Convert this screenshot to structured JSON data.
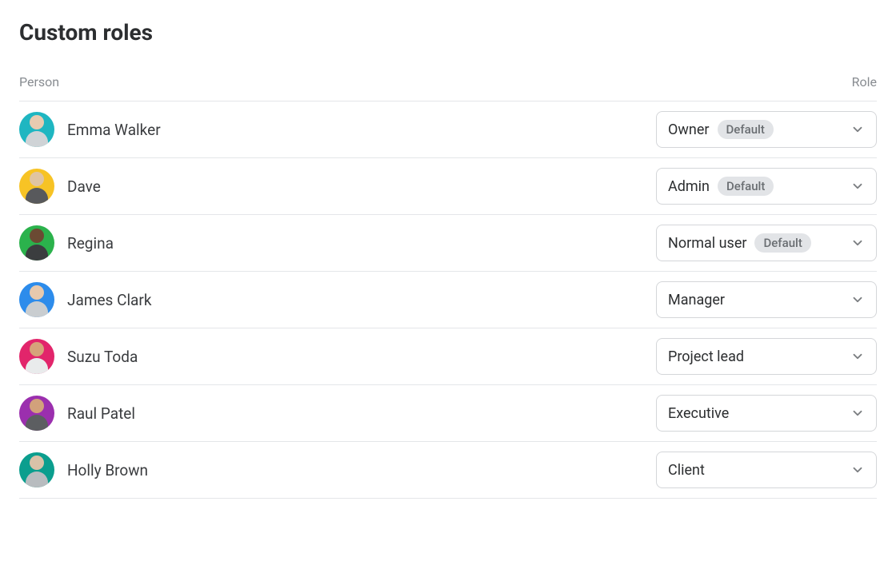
{
  "title": "Custom roles",
  "columns": {
    "person": "Person",
    "role": "Role"
  },
  "default_badge_label": "Default",
  "rows": [
    {
      "name": "Emma Walker",
      "role": "Owner",
      "default": true
    },
    {
      "name": "Dave",
      "role": "Admin",
      "default": true
    },
    {
      "name": "Regina",
      "role": "Normal user",
      "default": true
    },
    {
      "name": "James Clark",
      "role": "Manager",
      "default": false
    },
    {
      "name": "Suzu Toda",
      "role": "Project lead",
      "default": false
    },
    {
      "name": "Raul Patel",
      "role": "Executive",
      "default": false
    },
    {
      "name": "Holly Brown",
      "role": "Client",
      "default": false
    }
  ]
}
